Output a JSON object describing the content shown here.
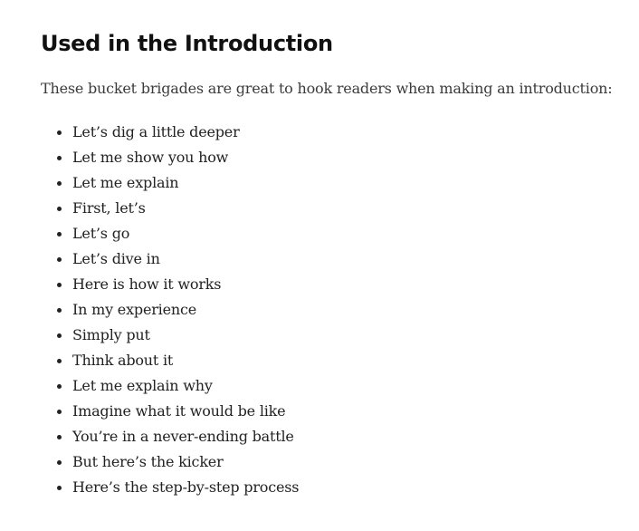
{
  "section": {
    "heading": "Used in the Introduction",
    "intro": "These bucket brigades are great to hook readers when making an introduction:",
    "items": [
      "Let’s dig a little deeper",
      "Let me show you how",
      "Let me explain",
      "First, let’s",
      "Let’s go",
      "Let’s dive in",
      "Here is how it works",
      "In my experience",
      "Simply put",
      "Think about it",
      "Let me explain why",
      "Imagine what it would be like",
      "You’re in a never-ending battle",
      "But here’s the kicker",
      "Here’s the step-by-step process"
    ]
  }
}
